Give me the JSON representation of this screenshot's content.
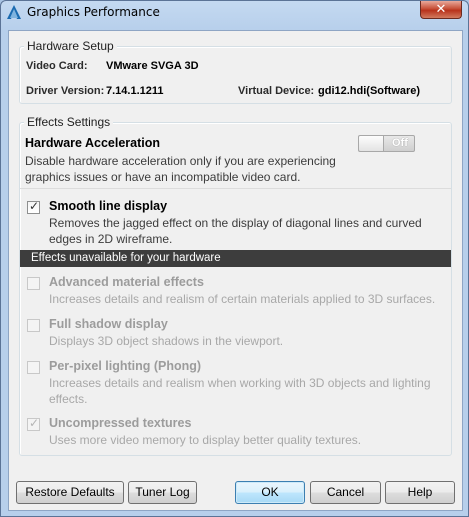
{
  "window": {
    "title": "Graphics Performance",
    "close_glyph": "✕",
    "app_icon": "autocad-logo-icon"
  },
  "hardware_setup": {
    "legend": "Hardware Setup",
    "video_card_label": "Video Card:",
    "video_card_value": "VMware SVGA 3D",
    "driver_version_label": "Driver Version:",
    "driver_version_value": "7.14.1.1211",
    "virtual_device_label": "Virtual Device:",
    "virtual_device_value": "gdi12.hdi(Software)"
  },
  "effects_settings": {
    "legend": "Effects Settings",
    "hardware_acceleration": {
      "title": "Hardware Acceleration",
      "description_line1": "Disable hardware acceleration only if you are experiencing",
      "description_line2": "graphics issues or have an incompatible video card.",
      "toggle_state": "Off"
    },
    "smooth_line": {
      "title": "Smooth line display",
      "checked": true,
      "description_line1": "Removes the jagged effect on the display of diagonal lines and curved",
      "description_line2": "edges in 2D wireframe."
    },
    "unavailable_banner": "Effects unavailable for your hardware",
    "unavailable_items": [
      {
        "title": "Advanced material effects",
        "checked": false,
        "description_line1": "Increases details and realism of certain materials applied to 3D surfaces.",
        "description_line2": ""
      },
      {
        "title": "Full shadow display",
        "checked": false,
        "description_line1": "Displays 3D object shadows in the viewport.",
        "description_line2": ""
      },
      {
        "title": "Per-pixel lighting (Phong)",
        "checked": false,
        "description_line1": "Increases details and realism when working with 3D objects and lighting",
        "description_line2": "effects."
      },
      {
        "title": "Uncompressed textures",
        "checked": true,
        "description_line1": "Uses more video memory to display better quality textures.",
        "description_line2": ""
      }
    ]
  },
  "buttons": {
    "restore_defaults": "Restore Defaults",
    "tuner_log": "Tuner Log",
    "ok": "OK",
    "cancel": "Cancel",
    "help": "Help"
  },
  "check_glyph": "✓"
}
